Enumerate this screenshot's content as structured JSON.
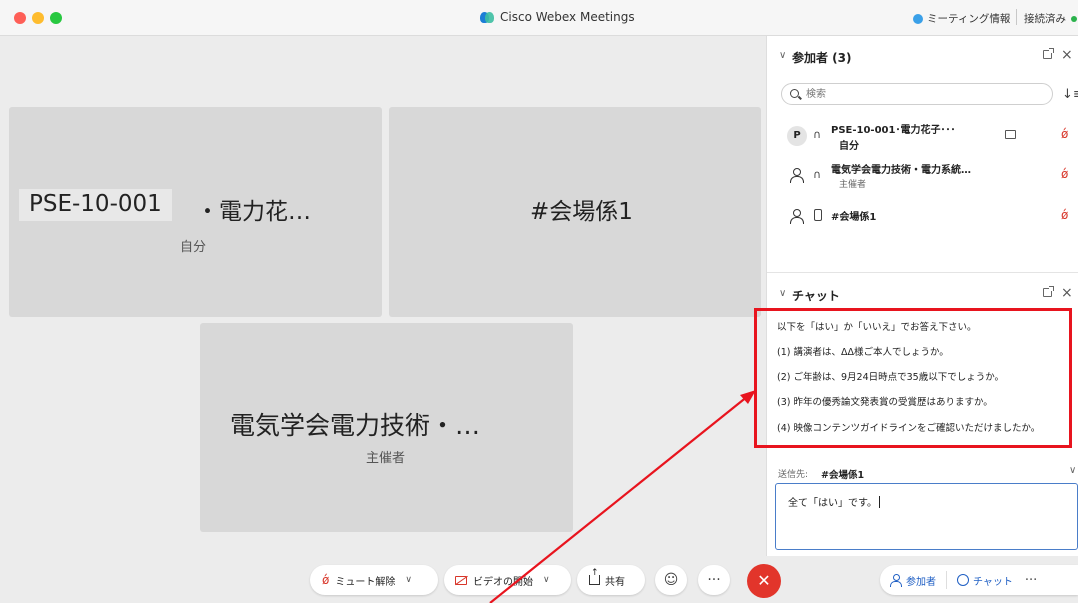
{
  "window": {
    "title": "Cisco Webex Meetings"
  },
  "header": {
    "meeting_info": "ミーティング情報",
    "status": "接続済み"
  },
  "tiles": {
    "self": {
      "id_label": "PSE-10-001",
      "name_rest": "・電力花…",
      "sub": "自分"
    },
    "venue": {
      "name": "#会場係1"
    },
    "host": {
      "name": "電気学会電力技術・…",
      "sub": "主催者"
    }
  },
  "participants": {
    "title": "参加者 (3)",
    "search_placeholder": "検索",
    "items": [
      {
        "initial": "P",
        "name": "PSE-10-001･電力花子･･･",
        "role": "自分"
      },
      {
        "name": "電気学会電力技術・電力系統…",
        "role": "主催者"
      },
      {
        "name": "#会場係1",
        "role": ""
      }
    ]
  },
  "chat": {
    "title": "チャット",
    "messages": [
      "以下を「はい」か「いいえ」でお答え下さい。",
      "(1) 講演者は、ΔΔ様ご本人でしょうか。",
      "(2) ご年齢は、9月24日時点で35歳以下でしょうか。",
      "(3) 昨年の優秀論文発表賞の受賞歴はありますか。",
      "(4) 映像コンテンツガイドラインをご確認いただけましたか。"
    ],
    "send_to_label": "送信先:",
    "send_to_value": "#会場係1",
    "compose_text": "全て「はい」です。"
  },
  "toolbar": {
    "unmute": "ミュート解除",
    "start_video": "ビデオの開始",
    "share": "共有",
    "participants": "参加者",
    "chat": "チャット"
  },
  "icons": {
    "emoji": "smiley-icon",
    "more": "ellipsis-icon",
    "end": "close-icon"
  },
  "colors": {
    "end_call": "#e2352b",
    "annotation": "#e8141e",
    "accent_blue": "#1f5fc4",
    "muted_red": "#d8362a"
  }
}
